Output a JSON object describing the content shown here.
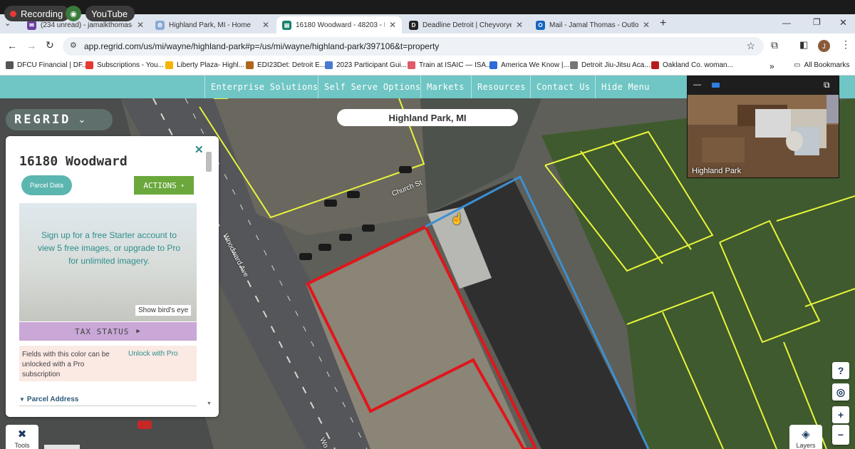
{
  "recording": {
    "recording_label": "Recording",
    "youtube_label": "YouTube"
  },
  "tabs": [
    {
      "label": "(234 unread) - jamalkthomas@",
      "color": "#6b3fa0",
      "glyph": "✉"
    },
    {
      "label": "Highland Park, MI - Home",
      "color": "#8aa9d6",
      "glyph": "⚙"
    },
    {
      "label": "16180 Woodward - 48203 - Re",
      "color": "#17806b",
      "glyph": "▤"
    },
    {
      "label": "Deadline Detroit | Cheyvoryea",
      "color": "#222222",
      "glyph": "D"
    },
    {
      "label": "Mail - Jamal Thomas - Outlook",
      "color": "#1565c0",
      "glyph": "O"
    }
  ],
  "address": {
    "url": "app.regrid.com/us/mi/wayne/highland-park#p=/us/mi/wayne/highland-park/397106&t=property",
    "profile_initial": "J"
  },
  "bookmarks": [
    {
      "label": "DFCU Financial | DF...",
      "color": "#555555"
    },
    {
      "label": "Subscriptions - You...",
      "color": "#e53935"
    },
    {
      "label": "Liberty Plaza- Highl...",
      "color": "#f4b400"
    },
    {
      "label": "EDI23Det: Detroit E...",
      "color": "#b0651d"
    },
    {
      "label": "2023 Participant Gui...",
      "color": "#4a7bd0"
    },
    {
      "label": "Train at ISAIC — ISA...",
      "color": "#e05a6a"
    },
    {
      "label": "America We Know |...",
      "color": "#2f6bd6"
    },
    {
      "label": "Detroit Jiu-Jitsu Aca...",
      "color": "#777777"
    },
    {
      "label": "Oakland Co. woman...",
      "color": "#b71c1c"
    }
  ],
  "all_bookmarks_label": "All Bookmarks",
  "site_nav": [
    "Enterprise Solutions",
    "Self Serve Options",
    "Markets",
    "Resources",
    "Contact Us",
    "Hide Menu"
  ],
  "brand": {
    "logo_text": "REGRID"
  },
  "map": {
    "place_label": "Highland Park, MI",
    "street_church": "Church St",
    "street_woodward": "Woodward Ave",
    "street_woodward_lower": "Wo"
  },
  "panel": {
    "title": "16180 Woodward",
    "parcel_data_button": "Parcel Data",
    "actions_button": "ACTIONS",
    "promo_text": "Sign up for a free Starter account to view 5 free images, or upgrade to Pro for unlimited imagery.",
    "birds_eye_button": "Show bird's eye",
    "tax_status_label": "TAX STATUS",
    "pro_note": "Fields with this color can be unlocked with a Pro subscription",
    "unlock_link": "Unlock with Pro",
    "section_header": "Parcel Address"
  },
  "bottom": {
    "tools_label": "Tools",
    "layers_label": "Layers"
  },
  "meeting": {
    "caption": "Highland Park"
  },
  "colors": {
    "teal": "#6fc6c4",
    "parcel_red": "#e0161b",
    "parcel_blue": "#3d8fd1",
    "lot_lines": "#e8f53a",
    "actions_green": "#6aa83c",
    "tax_purple": "#c9a7d6"
  }
}
